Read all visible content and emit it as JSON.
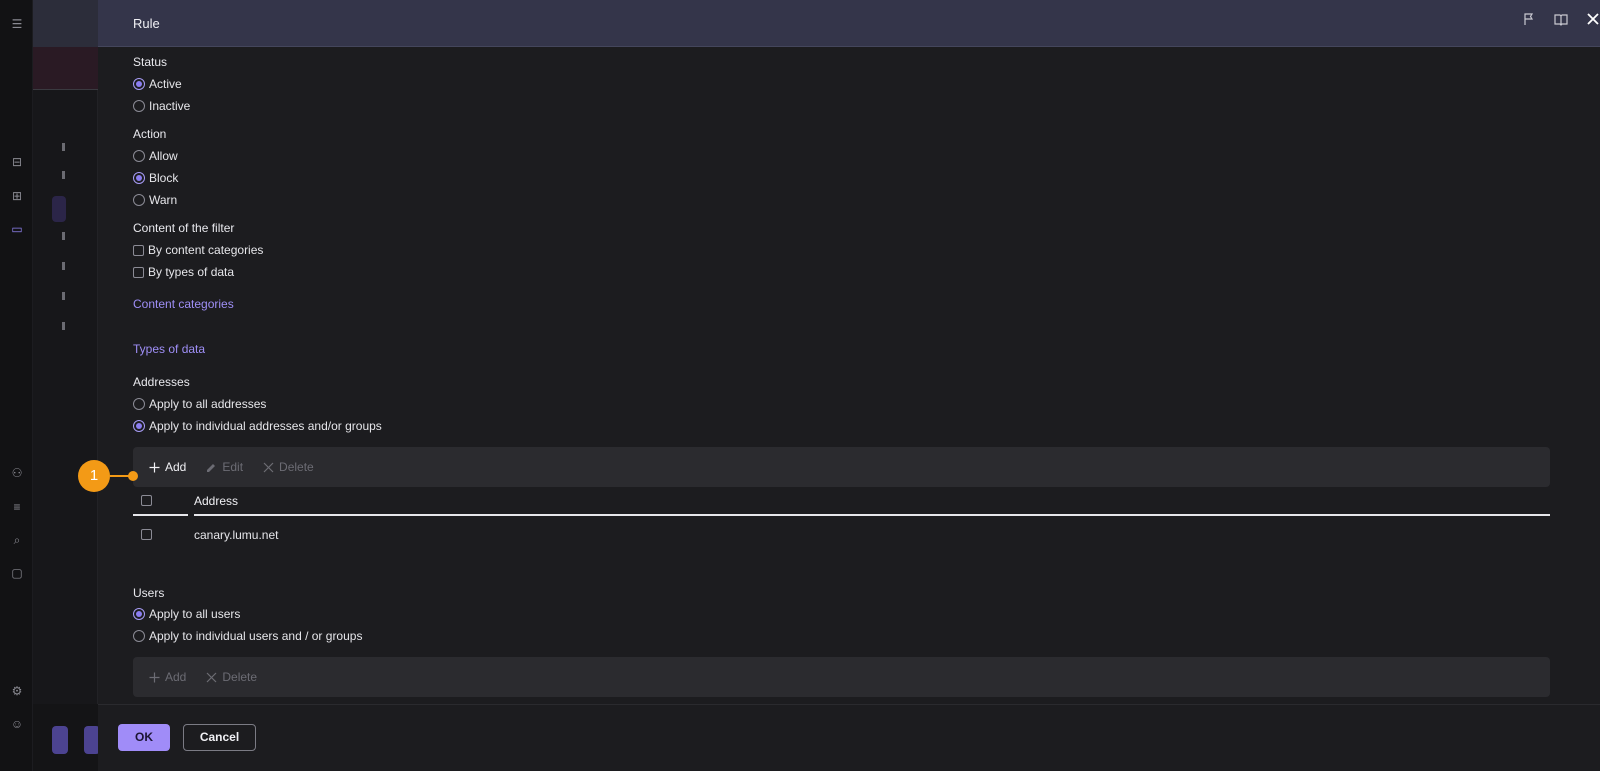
{
  "drawer": {
    "title": "Rule"
  },
  "status": {
    "label": "Status",
    "options": [
      "Active",
      "Inactive"
    ],
    "selected": "Active"
  },
  "action": {
    "label": "Action",
    "options": [
      "Allow",
      "Block",
      "Warn"
    ],
    "selected": "Block"
  },
  "content_filter": {
    "label": "Content of the filter",
    "options": [
      "By content categories",
      "By types of data"
    ]
  },
  "links": {
    "content_categories": "Content categories",
    "types_of_data": "Types of data"
  },
  "addresses": {
    "label": "Addresses",
    "options": [
      "Apply to all addresses",
      "Apply to individual addresses and/or groups"
    ],
    "selected": "Apply to individual addresses and/or groups",
    "toolbar": {
      "add": "Add",
      "edit": "Edit",
      "delete": "Delete"
    },
    "table": {
      "column_header": "Address",
      "rows": [
        "canary.lumu.net"
      ]
    }
  },
  "users": {
    "label": "Users",
    "options": [
      "Apply to all users",
      "Apply to individual users and / or groups"
    ],
    "selected": "Apply to all users",
    "toolbar": {
      "add": "Add",
      "delete": "Delete"
    }
  },
  "footer": {
    "ok": "OK",
    "cancel": "Cancel"
  },
  "callout": {
    "number": "1",
    "color": "#f39a16"
  },
  "colors": {
    "accent": "#9f8ff7",
    "header_bg": "#34354a",
    "drawer_bg": "#1c1c1f"
  }
}
